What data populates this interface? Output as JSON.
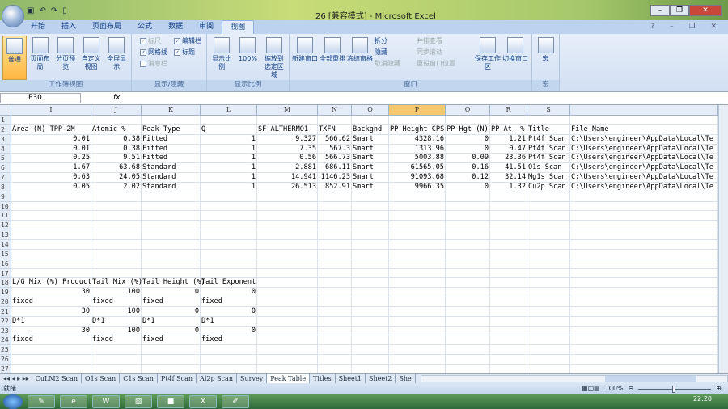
{
  "window": {
    "title": "26  [兼容模式] - Microsoft Excel",
    "qat": [
      "save",
      "undo",
      "redo",
      "new"
    ]
  },
  "ribbon_tabs": [
    "开始",
    "插入",
    "页面布局",
    "公式",
    "数据",
    "审阅",
    "视图"
  ],
  "ribbon": {
    "workbook_views": {
      "label": "工作簿视图",
      "buttons": [
        "普通",
        "页面布局",
        "分页预览",
        "自定义视图",
        "全屏显示"
      ]
    },
    "show_hide": {
      "label": "显示/隐藏",
      "items": [
        {
          "label": "标尺",
          "checked": true,
          "disabled": true
        },
        {
          "label": "编辑栏",
          "checked": true
        },
        {
          "label": "网格线",
          "checked": true
        },
        {
          "label": "标题",
          "checked": true
        },
        {
          "label": "消息栏",
          "checked": false,
          "disabled": true
        }
      ]
    },
    "zoom": {
      "label": "显示比例",
      "buttons": [
        "显示比例",
        "100%",
        "缩放到选定区域"
      ]
    },
    "window": {
      "label": "窗口",
      "buttons": [
        "新建窗口",
        "全部重排",
        "冻结窗格"
      ],
      "small": [
        "拆分",
        "隐藏",
        "取消隐藏"
      ],
      "small2": [
        "并排查看",
        "同步滚动",
        "重设窗口位置"
      ],
      "buttons2": [
        "保存工作区",
        "切换窗口"
      ]
    },
    "macros": {
      "label": "宏",
      "buttons": [
        "宏"
      ]
    }
  },
  "formula_bar": {
    "name_box": "P30",
    "fx": "fx",
    "value": ""
  },
  "columns": [
    "I",
    "J",
    "K",
    "L",
    "M",
    "N",
    "O",
    "P",
    "Q",
    "R",
    "S",
    ""
  ],
  "selected_column": "P",
  "rows": [
    [
      "",
      "",
      "",
      "",
      "",
      "",
      "",
      "",
      "",
      "",
      "",
      ""
    ],
    [
      "Area (N) TPP-2M",
      "Atomic %",
      "Peak Type",
      "Q",
      "SF ALTHERMO1",
      "TXFN",
      "Backgnd",
      "PP Height CPS",
      "PP Hgt (N)",
      "PP At. %",
      "Title",
      "File Name"
    ],
    [
      "0.01",
      "0.38",
      "Fitted",
      "1",
      "9.327",
      "566.62",
      "Smart",
      "4328.16",
      "0",
      "1.21",
      "Pt4f Scan",
      "C:\\Users\\engineer\\AppData\\Local\\Te"
    ],
    [
      "0.01",
      "0.38",
      "Fitted",
      "1",
      "7.35",
      "567.3",
      "Smart",
      "1313.96",
      "0",
      "0.47",
      "Pt4f Scan",
      "C:\\Users\\engineer\\AppData\\Local\\Te"
    ],
    [
      "0.25",
      "9.51",
      "Fitted",
      "1",
      "0.56",
      "566.73",
      "Smart",
      "5003.88",
      "0.09",
      "23.36",
      "Pt4f Scan",
      "C:\\Users\\engineer\\AppData\\Local\\Te"
    ],
    [
      "1.67",
      "63.68",
      "Standard",
      "1",
      "2.881",
      "686.11",
      "Smart",
      "61565.05",
      "0.16",
      "41.51",
      "O1s Scan",
      "C:\\Users\\engineer\\AppData\\Local\\Te"
    ],
    [
      "0.63",
      "24.05",
      "Standard",
      "1",
      "14.941",
      "1146.23",
      "Smart",
      "91093.68",
      "0.12",
      "32.14",
      "Mg1s Scan",
      "C:\\Users\\engineer\\AppData\\Local\\Te"
    ],
    [
      "0.05",
      "2.02",
      "Standard",
      "1",
      "26.513",
      "852.91",
      "Smart",
      "9966.35",
      "0",
      "1.32",
      "Cu2p Scan",
      "C:\\Users\\engineer\\AppData\\Local\\Te"
    ],
    [],
    [],
    [],
    [],
    [],
    [],
    [],
    [],
    [],
    [
      "L/G Mix (%) Product",
      "Tail  Mix (%)",
      "Tail Height (%)",
      "Tail Exponent"
    ],
    [
      "30",
      "100",
      "0",
      "0"
    ],
    [
      "fixed",
      "fixed",
      "fixed",
      "fixed"
    ],
    [
      "30",
      "100",
      "0",
      "0"
    ],
    [
      "D*1",
      "D*1",
      "D*1",
      "D*1"
    ],
    [
      "30",
      "100",
      "0",
      "0"
    ],
    [
      "fixed",
      "fixed",
      "fixed",
      "fixed"
    ],
    [],
    [],
    []
  ],
  "sheet_tabs": [
    "CuLM2 Scan",
    "O1s Scan",
    "C1s Scan",
    "Pt4f Scan",
    "Al2p Scan",
    "Survey",
    "Peak Table",
    "Titles",
    "Sheet1",
    "Sheet2",
    "She"
  ],
  "active_sheet": "Peak Table",
  "status": {
    "text": "就绪",
    "zoom": "100%"
  },
  "taskbar": {
    "clock": "22:20"
  }
}
